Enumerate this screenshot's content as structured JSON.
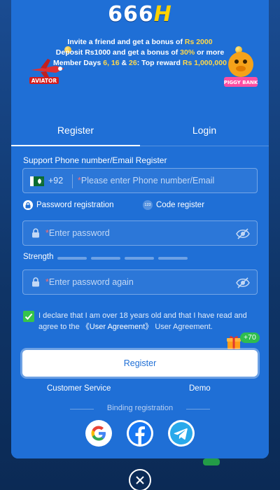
{
  "logo": {
    "main": "666",
    "accent": "H"
  },
  "promo": {
    "line1_a": "Invite a friend and get a bonus of ",
    "line1_b": "Rs 2000",
    "line2_a": "Deposit Rs1000 and get a bonus of ",
    "line2_b": "30%",
    "line2_c": " or more",
    "line3_a": "Member Days ",
    "line3_b": "6, 16",
    "line3_c": " & ",
    "line3_d": "26",
    "line3_e": ": Top reward ",
    "line3_f": "Rs 1,000,000",
    "aviator_label": "AVIATOR",
    "piggy_label": "PIGGY BANK"
  },
  "tabs": {
    "register": "Register",
    "login": "Login"
  },
  "form": {
    "section_label": "Support Phone number/Email Register",
    "country_code": "+92",
    "phone_placeholder": "Please enter Phone number/Email",
    "option_password": "Password registration",
    "option_code": "Code register",
    "code_icon_text": "123",
    "password_placeholder": "Enter password",
    "strength_label": "Strength",
    "password_again_placeholder": "Enter password again",
    "declare_text": "I declare that I am over 18 years old and that I have read and agree to the ",
    "agreement_link": "《User Agreement》",
    "declare_suffix": " User Agreement.",
    "gift_badge": "+70",
    "register_button": "Register",
    "customer_service": "Customer Service",
    "demo": "Demo",
    "binding_label": "Binding registration"
  },
  "colors": {
    "modal_bg": "#1f6fd6",
    "accent_yellow": "#ffd84a",
    "checkbox_green": "#36c44a"
  },
  "icons": [
    "pakistan-flag-icon",
    "lock-icon",
    "eye-off-icon",
    "google-icon",
    "facebook-icon",
    "telegram-icon",
    "gift-icon",
    "close-icon"
  ]
}
